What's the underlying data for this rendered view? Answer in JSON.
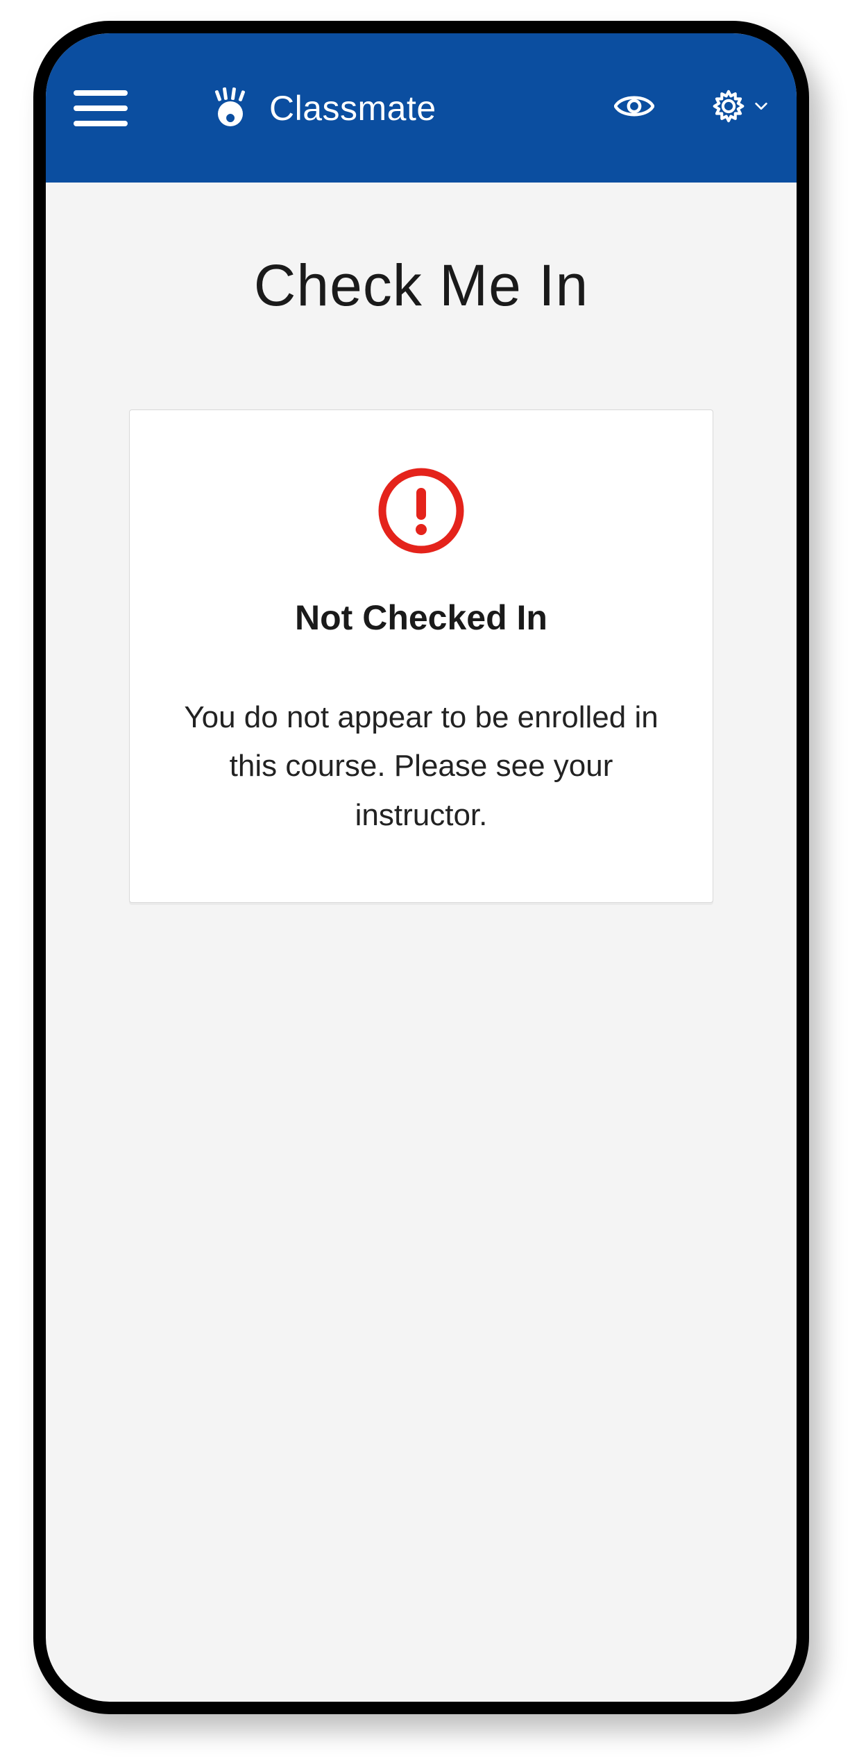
{
  "header": {
    "app_title": "Classmate"
  },
  "page": {
    "title": "Check Me In"
  },
  "card": {
    "status_heading": "Not Checked In",
    "message": "You do not appear to be enrolled in this course. Please see your instructor."
  },
  "colors": {
    "header_bg": "#0b4ea0",
    "alert": "#e4231b"
  }
}
